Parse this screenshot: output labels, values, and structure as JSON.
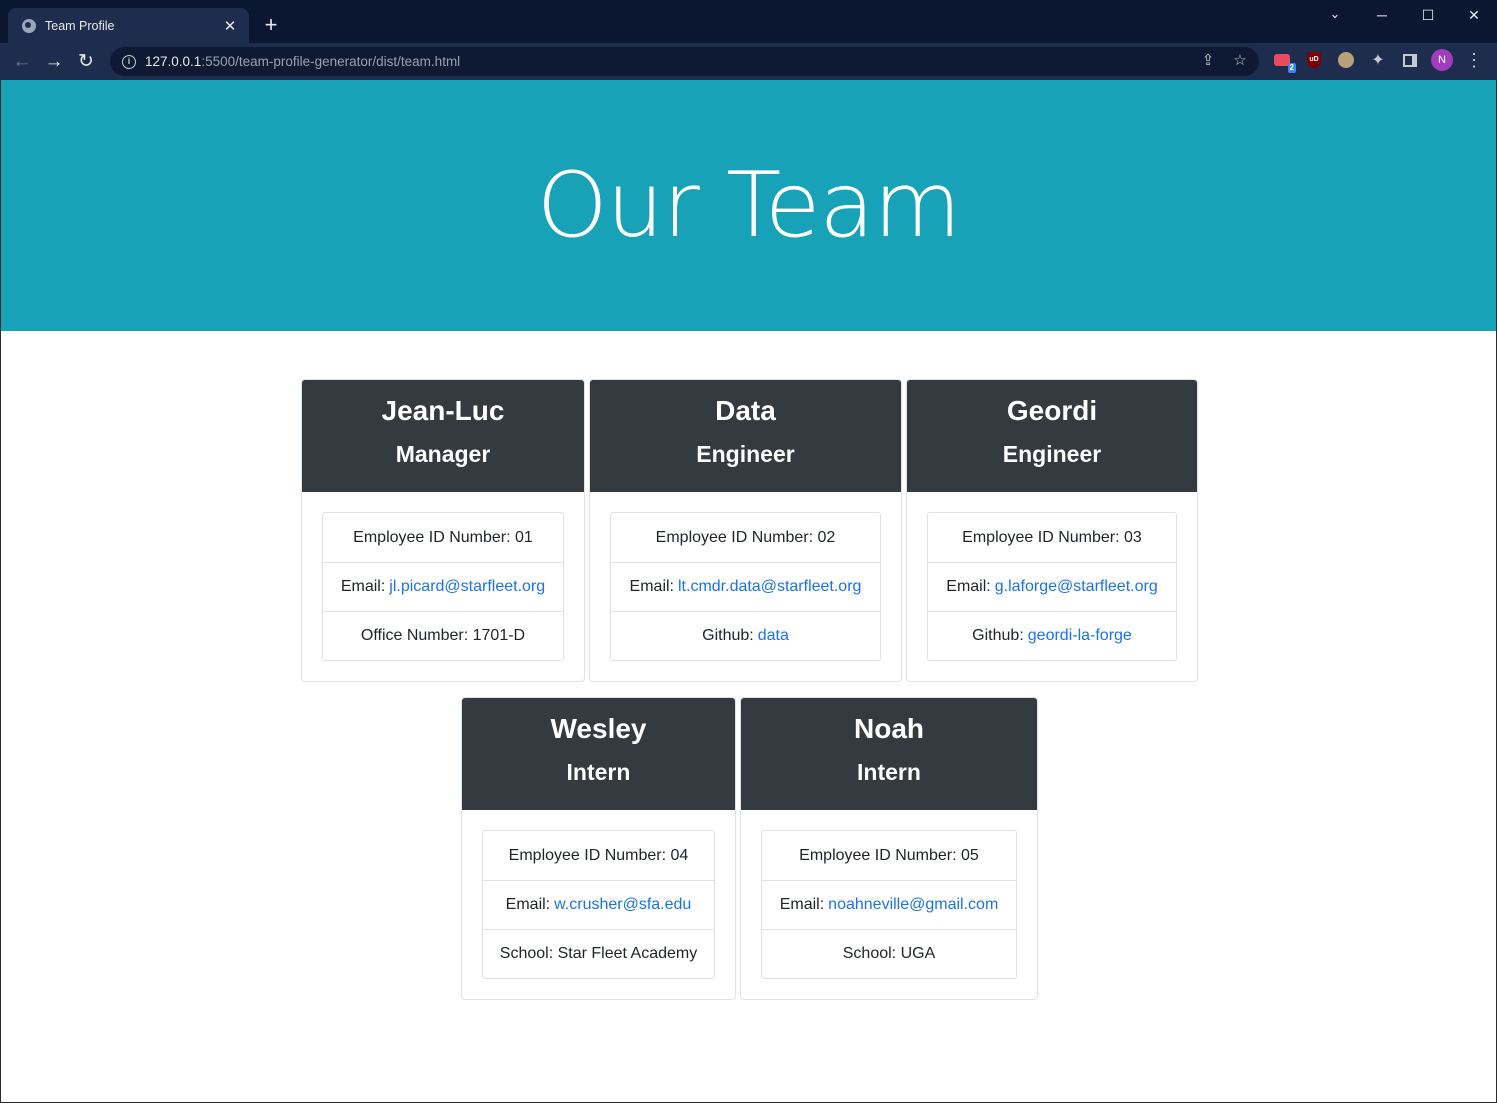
{
  "browser": {
    "tab_title": "Team Profile",
    "url_host": "127.0.0.1",
    "url_rest": ":5500/team-profile-generator/dist/team.html",
    "ext_badge": "2",
    "ext_ub_label": "uD",
    "avatar_initial": "N"
  },
  "page": {
    "title": "Our Team"
  },
  "team": [
    {
      "name": "Jean-Luc",
      "role": "Manager",
      "id_label": "Employee ID Number: 01",
      "email_label": "Email:",
      "email": "jl.picard@starfleet.org",
      "extra_label": "Office Number: 1701-D",
      "extra_link": ""
    },
    {
      "name": "Data",
      "role": "Engineer",
      "id_label": "Employee ID Number: 02",
      "email_label": "Email:",
      "email": "lt.cmdr.data@starfleet.org",
      "extra_label": "Github:",
      "extra_link": "data"
    },
    {
      "name": "Geordi",
      "role": "Engineer",
      "id_label": "Employee ID Number: 03",
      "email_label": "Email:",
      "email": "g.laforge@starfleet.org",
      "extra_label": "Github:",
      "extra_link": "geordi-la-forge"
    },
    {
      "name": "Wesley",
      "role": "Intern",
      "id_label": "Employee ID Number: 04",
      "email_label": "Email:",
      "email": "w.crusher@sfa.edu",
      "extra_label": "School: Star Fleet Academy",
      "extra_link": ""
    },
    {
      "name": "Noah",
      "role": "Intern",
      "id_label": "Employee ID Number: 05",
      "email_label": "Email:",
      "email": "noahneville@gmail.com",
      "extra_label": "School: UGA",
      "extra_link": ""
    }
  ]
}
